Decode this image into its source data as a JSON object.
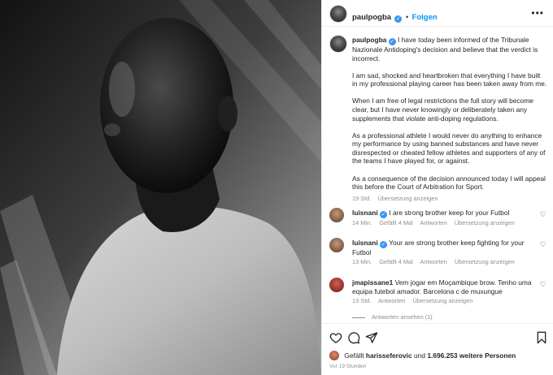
{
  "post": {
    "username": "paulpogba",
    "follow_label": "Folgen",
    "separator": "•",
    "more_icon": "more-dots-icon"
  },
  "caption": {
    "username": "paulpogba",
    "paragraphs": [
      "I have today been informed of the Tribunale Nazionale Antidoping's decision and believe that the verdict is incorrect.",
      "I am sad, shocked and heartbroken that everything I have built in my professional playing career has been taken away from me.",
      "When I am free of legal restrictions the full story will become clear, but I have never knowingly or deliberately taken any supplements that violate anti-doping regulations.",
      "As a professional athlete I would never do anything to enhance my performance by using banned substances and have never disrespected or cheated fellow athletes and supporters of any of the teams I have played for, or against.",
      "As a consequence of the decision announced today I will appeal this before the Court of Arbitration for Sport."
    ],
    "time": "19 Std.",
    "translate_label": "Übersetzung anzeigen"
  },
  "comments": [
    {
      "username": "luisnani",
      "text": "I are strong brother keep for your Futbol",
      "time": "14 Min.",
      "likes": "Gefällt 4 Mal",
      "reply_label": "Antworten",
      "translate_label": "Übersetzung anzeigen"
    },
    {
      "username": "luisnani",
      "text": "Your are strong brother keep fighting for your Futbol",
      "time": "13 Min.",
      "likes": "Gefällt 4 Mal",
      "reply_label": "Antworten",
      "translate_label": "Übersetzung anzeigen"
    },
    {
      "username": "jmapissane1",
      "text": "Vem jogar em Moçambique brow. Tenho uma equipa futebol amador. Barcelona c de muxungue",
      "time": "13 Std.",
      "reply_label": "Antworten",
      "translate_label": "Übersetzung anzeigen"
    }
  ],
  "view_replies_label": "Antworten ansehen (1)",
  "likes_summary": {
    "prefix": "Gefällt",
    "user": "harisseferovic",
    "and": "und",
    "count": "1.696.253 weitere Personen"
  },
  "post_age": "Vor 19 Stunden",
  "colors": {
    "link_blue": "#0095f6",
    "verified_blue": "#3897f0",
    "meta_gray": "#8e8e8e",
    "text": "#262626"
  },
  "icons": [
    "heart-icon",
    "comment-icon",
    "share-icon",
    "bookmark-icon",
    "verified-badge-icon"
  ]
}
